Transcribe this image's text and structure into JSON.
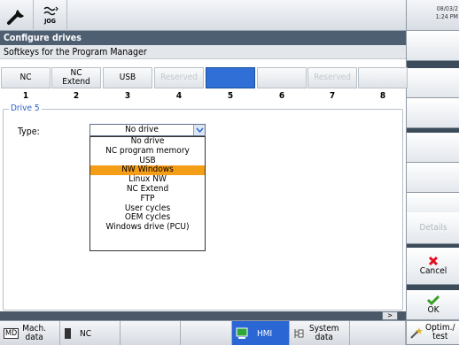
{
  "window": {
    "clock_date": "08/03/2",
    "clock_time": "1:24 PM",
    "jog_label": "JOG"
  },
  "title": "Configure drives",
  "subtitle": "Softkeys for the Program Manager",
  "preview_softkeys": [
    {
      "line1": "NC",
      "line2": "",
      "state": "normal"
    },
    {
      "line1": "NC",
      "line2": "Extend",
      "state": "normal"
    },
    {
      "line1": "USB",
      "line2": "",
      "state": "normal"
    },
    {
      "line1": "Reserved",
      "line2": "",
      "state": "reserved"
    },
    {
      "line1": "",
      "line2": "",
      "state": "selected"
    },
    {
      "line1": "",
      "line2": "",
      "state": "empty"
    },
    {
      "line1": "Reserved",
      "line2": "",
      "state": "reserved"
    },
    {
      "line1": "",
      "line2": "",
      "state": "empty"
    }
  ],
  "softkey_numbers": [
    "1",
    "2",
    "3",
    "4",
    "5",
    "6",
    "7",
    "8"
  ],
  "drive": {
    "legend": "Drive 5",
    "type_label": "Type:",
    "selected_value": "No drive",
    "options": [
      "No drive",
      "NC program memory",
      "USB",
      "NW Windows",
      "Linux NW",
      "NC Extend",
      "FTP",
      "User cycles",
      "OEM cycles",
      "Windows drive (PCU)"
    ],
    "highlighted_index": 3
  },
  "vertical_softkeys": {
    "details": "Details",
    "cancel": "Cancel",
    "ok": "OK"
  },
  "horizontal_softkeys": {
    "md_icon": "MD",
    "mach_data_1": "Mach.",
    "mach_data_2": "data",
    "nc": "NC",
    "hmi": "HMI",
    "system_data_1": "System",
    "system_data_2": "data",
    "optim_1": "Optim./",
    "optim_2": "test"
  },
  "scroll_arrow": ">",
  "colors": {
    "title_bar": "#4f5f72",
    "highlight": "#f49d16",
    "selected_key": "#2f6fd6",
    "legend": "#2a62c4",
    "cancel": "#e3101b",
    "ok": "#3aa024"
  }
}
